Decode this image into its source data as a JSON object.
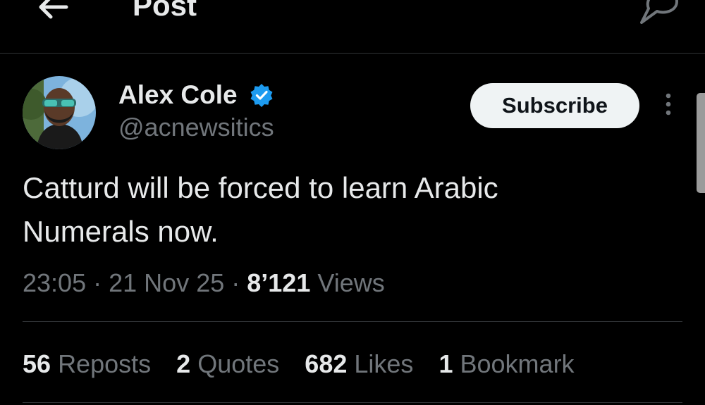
{
  "header": {
    "title": "Post",
    "back_icon": "arrow-left-icon",
    "reply_icon": "reply-icon"
  },
  "post": {
    "author": {
      "name": "Alex Cole",
      "handle": "@acnewsitics",
      "verified": true,
      "verified_color": "#1d9bf0"
    },
    "subscribe_label": "Subscribe",
    "text_line1": "Catturd will be forced to learn Arabic",
    "text_line2": "Numerals now.",
    "time": "23:05",
    "date": "21 Nov 25",
    "separator": "·",
    "views_count": "8’121",
    "views_label": "Views"
  },
  "stats": {
    "reposts": {
      "count": "56",
      "label": "Reposts"
    },
    "quotes": {
      "count": "2",
      "label": "Quotes"
    },
    "likes": {
      "count": "682",
      "label": "Likes"
    },
    "bookmarks": {
      "count": "1",
      "label": "Bookmark"
    }
  },
  "colors": {
    "background": "#000000",
    "text": "#e7e9ea",
    "secondary": "#71767b",
    "border": "#2f3336"
  }
}
